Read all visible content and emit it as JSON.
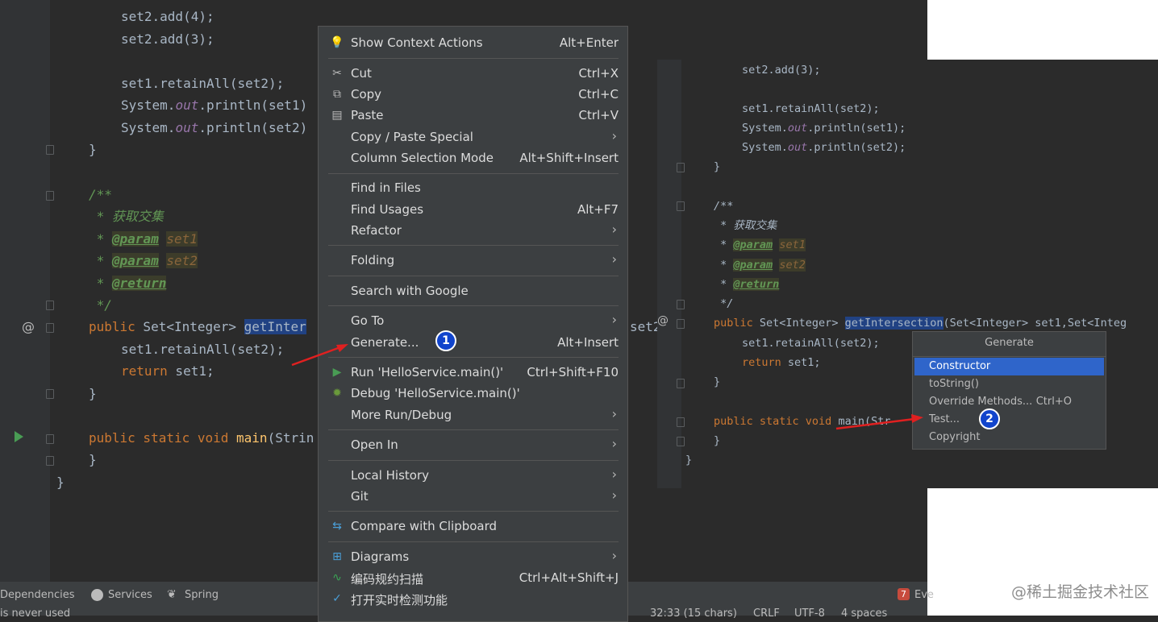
{
  "left_code": {
    "line1": "set2.add(4);",
    "line2": "set2.add(3);",
    "line3": "set1.retainAll(set2);",
    "line4a": "System.",
    "line4b": "out",
    "line4c": ".println(set1)",
    "line5a": "System.",
    "line5b": "out",
    "line5c": ".println(set2)",
    "brace1": "}",
    "doc_open": "/**",
    "doc_desc": " * 获取交集",
    "doc_param1_star": " * ",
    "doc_param1_tag": "@param",
    "doc_param1_val": "set1",
    "doc_param2_star": " * ",
    "doc_param2_tag": "@param",
    "doc_param2_val": "set2",
    "doc_return_star": " * ",
    "doc_return_tag": "@return",
    "doc_close": " */",
    "sig_public": "public",
    "sig_type": " Set<Integer> ",
    "sig_method": "getInter",
    "sig_tail": "set2",
    "body1": "set1.retainAll(set2);",
    "body2_kw": "return",
    "body2_rest": " set1;",
    "brace2": "}",
    "main_kw": "public static void",
    "main_name": "main",
    "main_rest": "(Strin",
    "brace3": "}",
    "brace4": "}",
    "gutter_at": "@"
  },
  "context_menu": {
    "items": [
      {
        "label": "Show Context Actions",
        "shortcut": "Alt+Enter",
        "icon": "bulb-icon"
      },
      {
        "label": "Cut",
        "shortcut": "Ctrl+X",
        "icon": "scissors-icon"
      },
      {
        "label": "Copy",
        "shortcut": "Ctrl+C",
        "icon": "copy-icon"
      },
      {
        "label": "Paste",
        "shortcut": "Ctrl+V",
        "icon": "clipboard-icon"
      },
      {
        "label": "Copy / Paste Special",
        "shortcut": "",
        "submenu": true
      },
      {
        "label": "Column Selection Mode",
        "shortcut": "Alt+Shift+Insert"
      },
      {
        "label": "Find in Files",
        "shortcut": ""
      },
      {
        "label": "Find Usages",
        "shortcut": "Alt+F7"
      },
      {
        "label": "Refactor",
        "shortcut": "",
        "submenu": true
      },
      {
        "label": "Folding",
        "shortcut": "",
        "submenu": true
      },
      {
        "label": "Search with Google",
        "shortcut": ""
      },
      {
        "label": "Go To",
        "shortcut": "",
        "submenu": true
      },
      {
        "label": "Generate...",
        "shortcut": "Alt+Insert"
      },
      {
        "label": "Run 'HelloService.main()'",
        "shortcut": "Ctrl+Shift+F10",
        "icon": "run-icon"
      },
      {
        "label": "Debug 'HelloService.main()'",
        "shortcut": "",
        "icon": "debug-icon"
      },
      {
        "label": "More Run/Debug",
        "shortcut": "",
        "submenu": true
      },
      {
        "label": "Open In",
        "shortcut": "",
        "submenu": true
      },
      {
        "label": "Local History",
        "shortcut": "",
        "submenu": true
      },
      {
        "label": "Git",
        "shortcut": "",
        "submenu": true
      },
      {
        "label": "Compare with Clipboard",
        "shortcut": "",
        "icon": "compare-icon"
      },
      {
        "label": "Diagrams",
        "shortcut": "",
        "submenu": true,
        "icon": "diagram-icon"
      },
      {
        "label": "编码规约扫描",
        "shortcut": "Ctrl+Alt+Shift+J",
        "icon": "scan-icon"
      },
      {
        "label": "打开实时检测功能",
        "shortcut": "",
        "icon": "check-circle-icon"
      }
    ],
    "submenu_arrow": "›"
  },
  "right_code": {
    "r1": "set2.add(3);",
    "r2": "set1.retainAll(set2);",
    "r3a": "System.",
    "r3b": "out",
    "r3c": ".println(set1);",
    "r4a": "System.",
    "r4b": "out",
    "r4c": ".println(set2);",
    "r5": "}",
    "r6": "/**",
    "r7": " * 获取交集",
    "r8s": " * ",
    "r8t": "@param",
    "r8v": "set1",
    "r9s": " * ",
    "r9t": "@param",
    "r9v": "set2",
    "r10s": " * ",
    "r10t": "@return",
    "r11": " */",
    "r12a": "public",
    "r12b": " Set<Integer> ",
    "r12c": "getIntersection",
    "r12d": "(Set<Integer> set1,Set<Integ",
    "r13": "set1.retainAll(set2);",
    "r14a": "return",
    "r14b": " set1;",
    "r15": "}",
    "r16a": "public static void",
    "r16b": " main(Str",
    "r17": "}",
    "r18": "}",
    "at": "@"
  },
  "generate_popup": {
    "title": "Generate",
    "items": [
      {
        "label": "Constructor",
        "shortcut": "",
        "selected": true
      },
      {
        "label": "toString()",
        "shortcut": ""
      },
      {
        "label": "Override Methods...",
        "shortcut": "Ctrl+O"
      },
      {
        "label": "Test...",
        "shortcut": ""
      },
      {
        "label": "Copyright",
        "shortcut": ""
      }
    ]
  },
  "toolbar": {
    "dependencies": "Dependencies",
    "services": "Services",
    "spring": "Spring",
    "event_count": "7",
    "event_label": "Eve",
    "status_left": "is never used",
    "status_pos": "32:33 (15 chars)",
    "status_crlf": "CRLF",
    "status_enc": "UTF-8",
    "status_indent": "4 spaces"
  },
  "badges": {
    "one": "1",
    "two": "2"
  },
  "watermark": "@稀土掘金技术社区",
  "colors": {
    "accent": "#2f65ca",
    "badge": "#1144cc",
    "arrow": "#e02020"
  }
}
